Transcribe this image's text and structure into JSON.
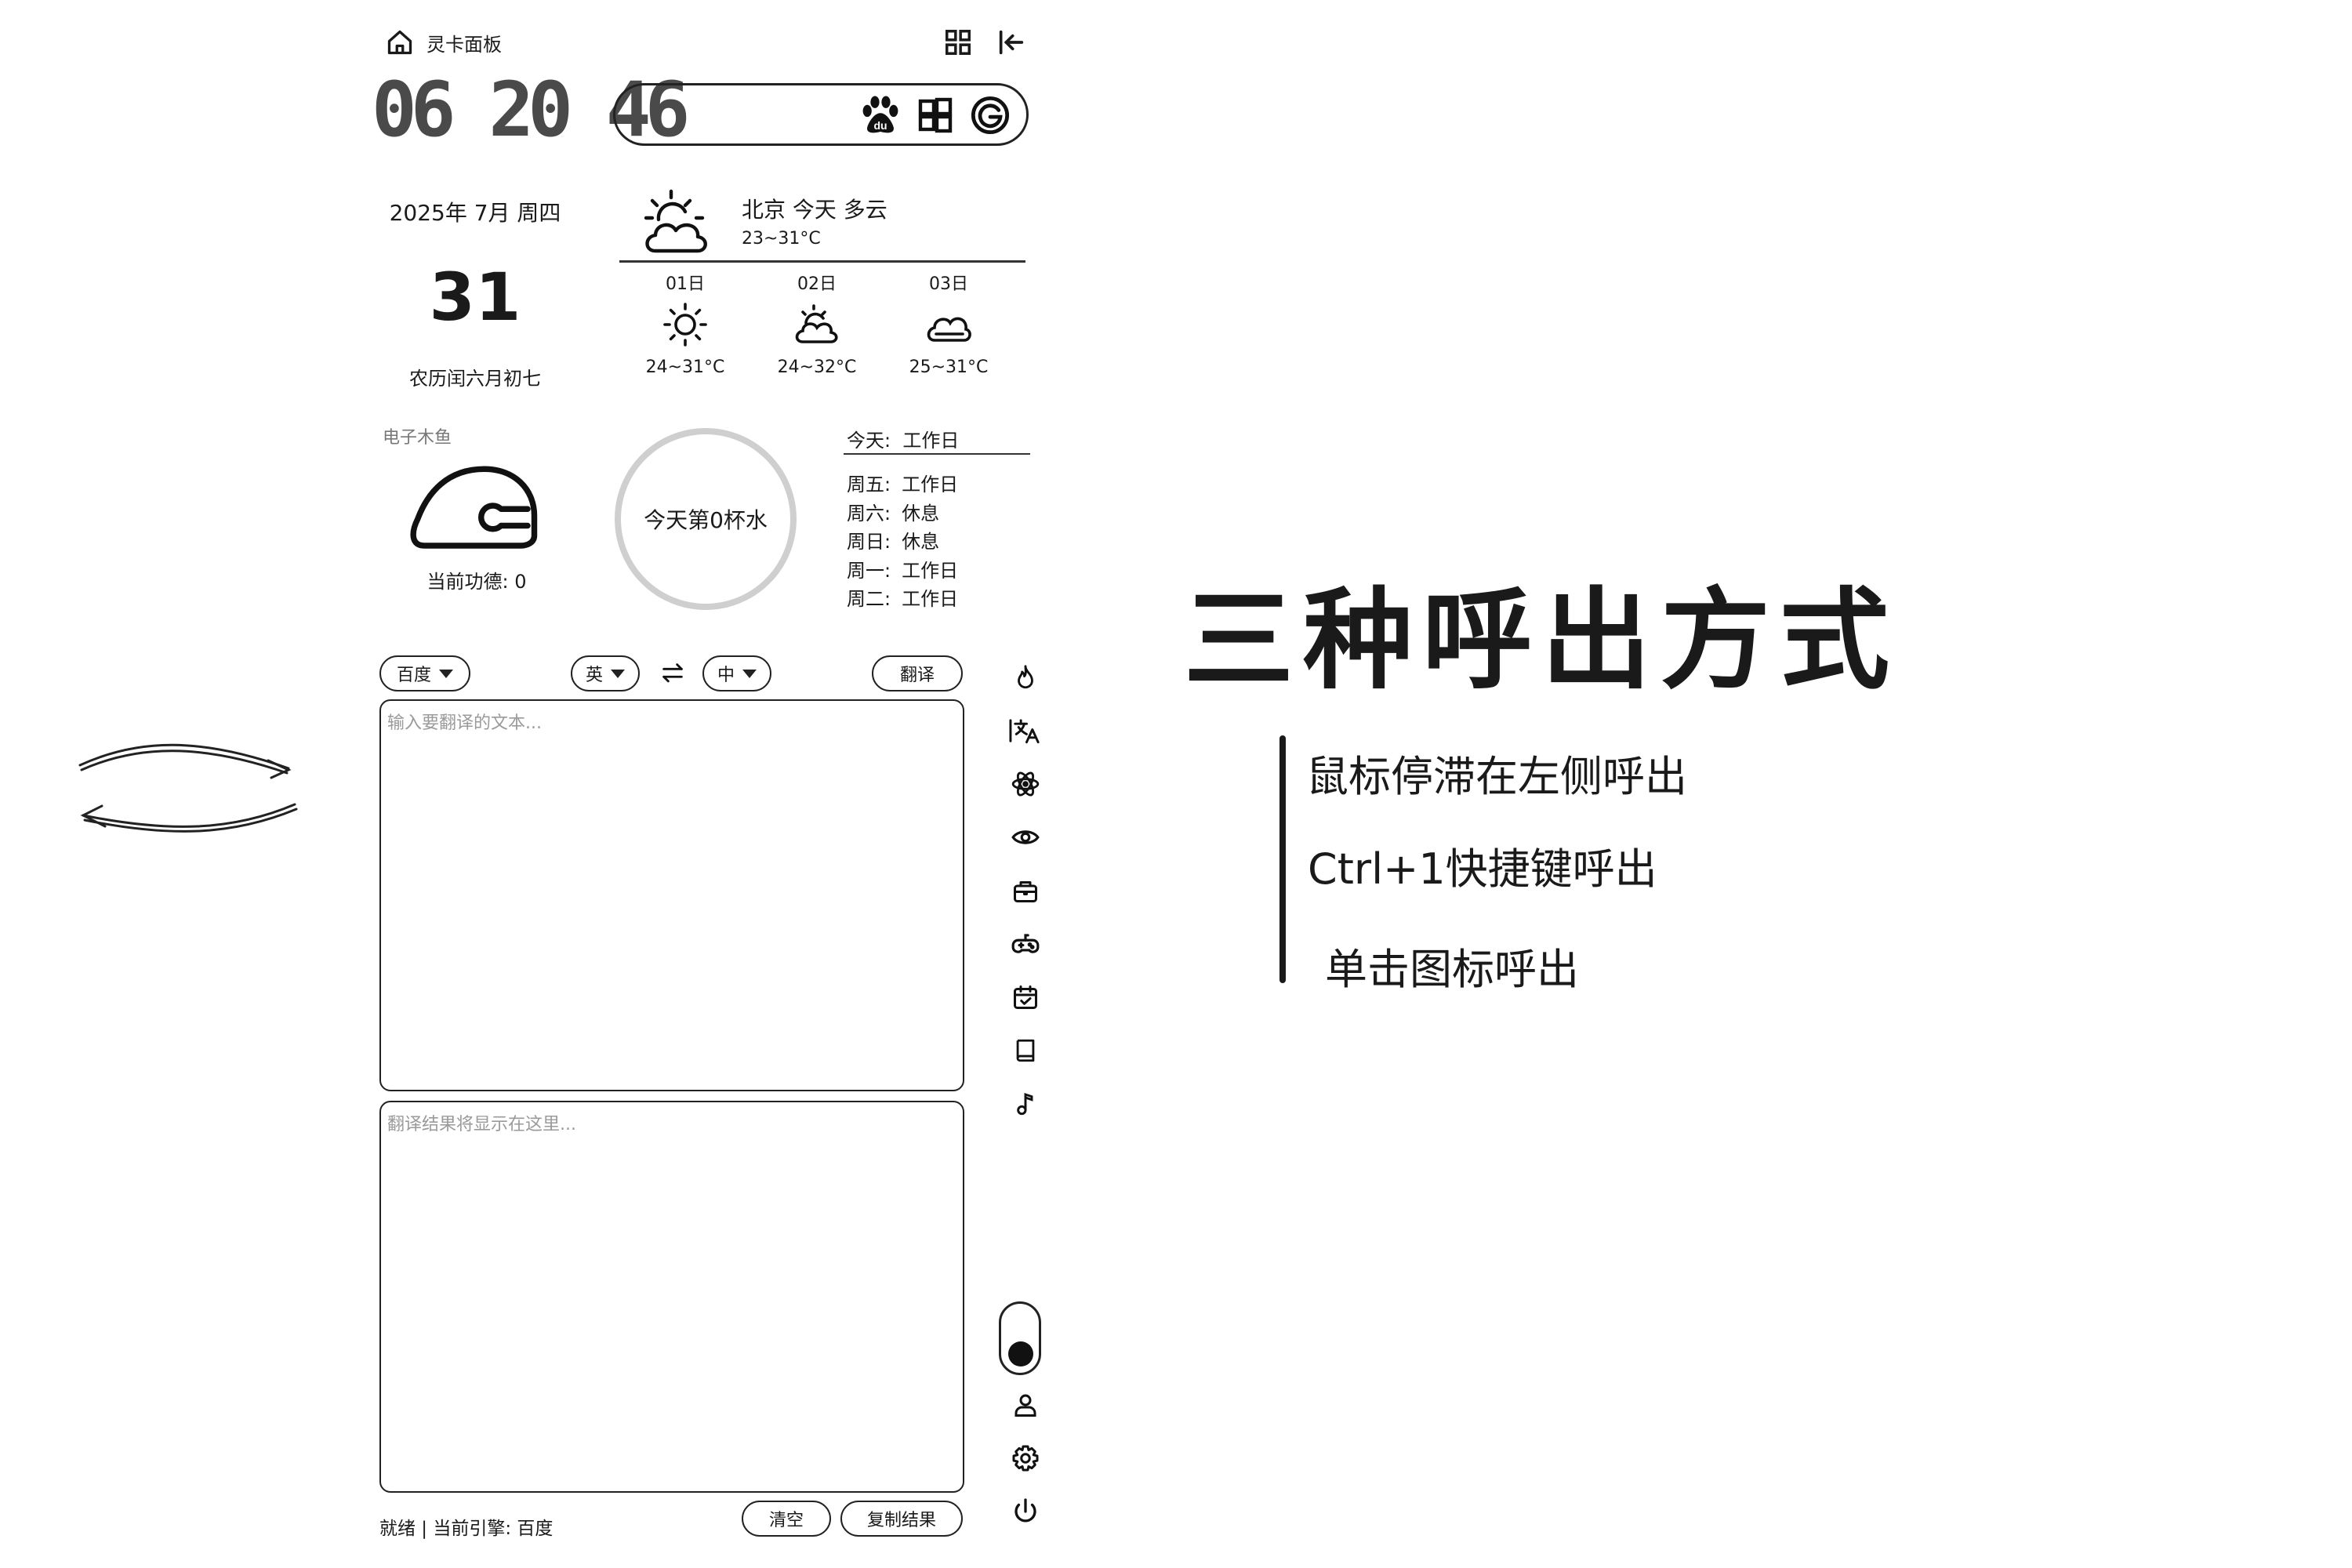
{
  "header": {
    "title": "灵卡面板",
    "home_icon": "home-icon",
    "grid_icon": "grid-icon",
    "collapse_icon": "collapse-left-icon"
  },
  "clock": {
    "time": "06 20 46"
  },
  "search": {
    "placeholder": "",
    "engines": [
      "baidu-icon",
      "windows-icon",
      "google-icon"
    ]
  },
  "calendar": {
    "date_line": "2025年 7月 周四",
    "day": "31",
    "lunar": "农历闰六月初七"
  },
  "weather": {
    "city_line": "北京 今天 多云",
    "range": "23~31°C",
    "forecast": [
      {
        "date": "01日",
        "icon": "sunny-icon",
        "temp": "24~31°C"
      },
      {
        "date": "02日",
        "icon": "partly-cloudy-icon",
        "temp": "24~32°C"
      },
      {
        "date": "03日",
        "icon": "cloudy-icon",
        "temp": "25~31°C"
      }
    ]
  },
  "muyu": {
    "label": "电子木鱼",
    "merit": "当前功德: 0"
  },
  "water": {
    "label": "今天第0杯水"
  },
  "workdays": {
    "today_label": "今天:",
    "today_value": "工作日",
    "rows": [
      {
        "day": "周五:",
        "status": "工作日"
      },
      {
        "day": "周六:",
        "status": "休息"
      },
      {
        "day": "周日:",
        "status": "休息"
      },
      {
        "day": "周一:",
        "status": "工作日"
      },
      {
        "day": "周二:",
        "status": "工作日"
      }
    ]
  },
  "translate": {
    "engine": "百度",
    "source_lang": "英",
    "swap_icon": "swap-icon",
    "target_lang": "中",
    "translate_button": "翻译",
    "input_placeholder": "输入要翻译的文本...",
    "output_placeholder": "翻译结果将显示在这里...",
    "status": "就绪 | 当前引擎: 百度",
    "clear_button": "清空",
    "copy_button": "复制结果"
  },
  "sidebar": {
    "icons": [
      "fire-icon",
      "translate-icon",
      "atom-icon",
      "eye-icon",
      "toolbox-icon",
      "gamepad-icon",
      "calendar-check-icon",
      "book-icon",
      "music-icon"
    ],
    "bottom_icons": [
      "user-icon",
      "settings-icon",
      "power-icon"
    ]
  },
  "annotation": {
    "title": "三种呼出方式",
    "items": [
      "鼠标停滞在左侧呼出",
      "Ctrl+1快捷键呼出",
      "单击图标呼出"
    ]
  }
}
